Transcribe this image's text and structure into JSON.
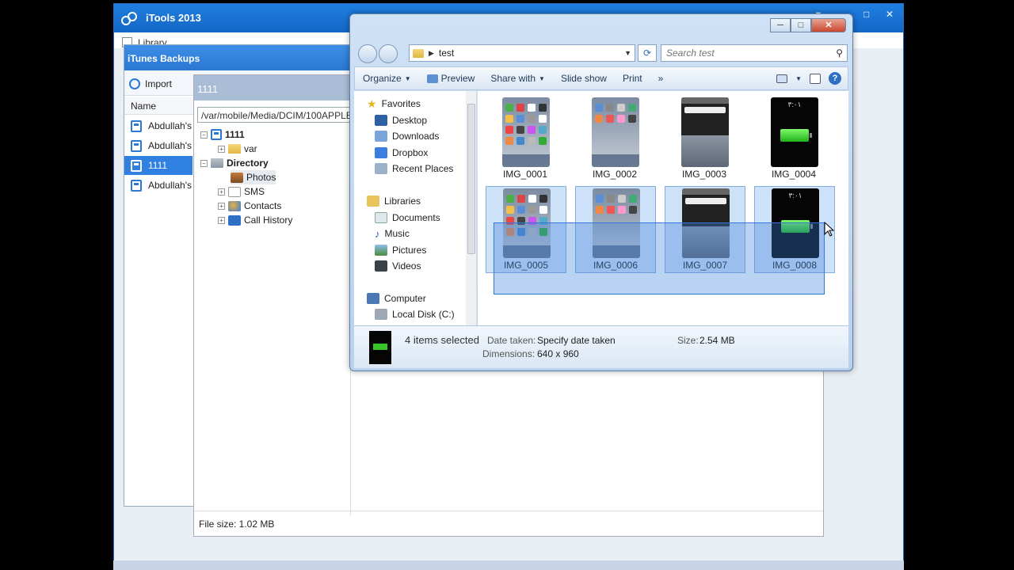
{
  "itools": {
    "title": "iTools 2013",
    "library_label": "Library",
    "controls": [
      "▾",
      "─",
      "□",
      "✕"
    ]
  },
  "backups": {
    "title": "iTunes Backups",
    "import_label": "Import",
    "name_header": "Name",
    "items": [
      {
        "label": "Abdullah's",
        "selected": false
      },
      {
        "label": "Abdullah's",
        "selected": false
      },
      {
        "label": "1111",
        "selected": true
      },
      {
        "label": "Abdullah's",
        "selected": false
      }
    ]
  },
  "browser": {
    "title": "1111",
    "path": "/var/mobile/Media/DCIM/100APPLE",
    "tree": {
      "root": "1111",
      "var": "var",
      "directory": "Directory",
      "photos": "Photos",
      "sms": "SMS",
      "contacts": "Contacts",
      "call_history": "Call History"
    },
    "file_size": "File size: 1.02 MB"
  },
  "explorer": {
    "address": "test",
    "search_placeholder": "Search test",
    "commands": {
      "organize": "Organize",
      "preview": "Preview",
      "share_with": "Share with",
      "slide_show": "Slide show",
      "print": "Print",
      "more": "»"
    },
    "nav": {
      "favorites": "Favorites",
      "desktop": "Desktop",
      "downloads": "Downloads",
      "dropbox": "Dropbox",
      "recent_places": "Recent Places",
      "libraries": "Libraries",
      "documents": "Documents",
      "music": "Music",
      "pictures": "Pictures",
      "videos": "Videos",
      "computer": "Computer",
      "local_disk": "Local Disk (C:)"
    },
    "files": [
      {
        "name": "IMG_0001",
        "kind": "home",
        "selected": false
      },
      {
        "name": "IMG_0002",
        "kind": "home",
        "selected": false
      },
      {
        "name": "IMG_0003",
        "kind": "keyboard",
        "selected": false
      },
      {
        "name": "IMG_0004",
        "kind": "battery",
        "selected": false
      },
      {
        "name": "IMG_0005",
        "kind": "home",
        "selected": true
      },
      {
        "name": "IMG_0006",
        "kind": "home",
        "selected": true
      },
      {
        "name": "IMG_0007",
        "kind": "keyboard",
        "selected": true
      },
      {
        "name": "IMG_0008",
        "kind": "battery",
        "selected": true
      }
    ],
    "battery_clock": "٣:٠١",
    "details": {
      "count": "4 items selected",
      "date_label": "Date taken:",
      "date_value": "Specify date taken",
      "dim_label": "Dimensions:",
      "dim_value": "640 x 960",
      "size_label": "Size:",
      "size_value": "2.54 MB"
    }
  }
}
